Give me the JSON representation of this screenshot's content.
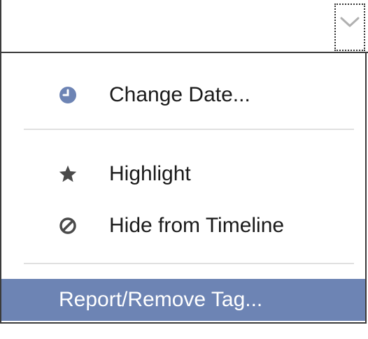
{
  "menu": {
    "items": [
      {
        "label": "Change Date...",
        "icon": "clock-icon"
      },
      {
        "label": "Highlight",
        "icon": "star-icon"
      },
      {
        "label": "Hide from Timeline",
        "icon": "prohibited-icon"
      }
    ],
    "highlighted_item": {
      "label": "Report/Remove Tag..."
    }
  },
  "colors": {
    "highlight_bg": "#6d84b4",
    "clock_icon": "#6d84b4",
    "border": "#3b3b3b"
  }
}
